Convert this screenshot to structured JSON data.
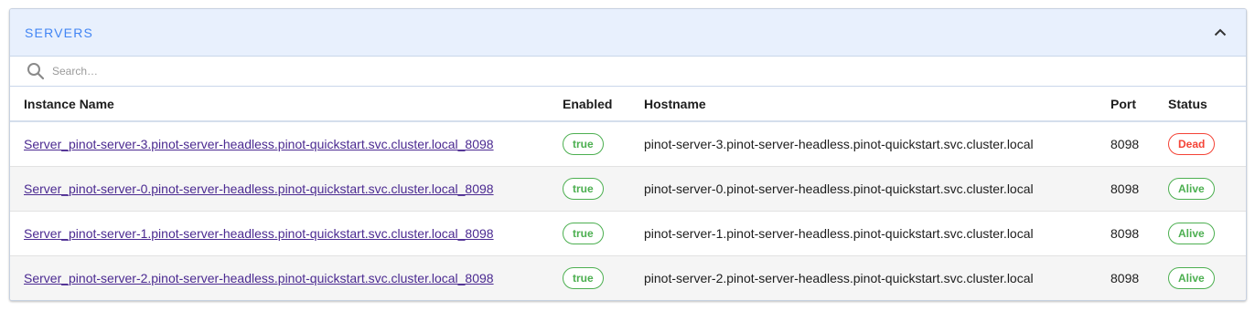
{
  "panel": {
    "title": "SERVERS",
    "collapse_icon": "chevron-up-icon"
  },
  "search": {
    "placeholder": "Search…",
    "value": "",
    "icon": "search-icon"
  },
  "table": {
    "columns": [
      "Instance Name",
      "Enabled",
      "Hostname",
      "Port",
      "Status"
    ],
    "rows": [
      {
        "instance_name": "Server_pinot-server-3.pinot-server-headless.pinot-quickstart.svc.cluster.local_8098",
        "enabled": "true",
        "hostname": "pinot-server-3.pinot-server-headless.pinot-quickstart.svc.cluster.local",
        "port": "8098",
        "status": "Dead"
      },
      {
        "instance_name": "Server_pinot-server-0.pinot-server-headless.pinot-quickstart.svc.cluster.local_8098",
        "enabled": "true",
        "hostname": "pinot-server-0.pinot-server-headless.pinot-quickstart.svc.cluster.local",
        "port": "8098",
        "status": "Alive"
      },
      {
        "instance_name": "Server_pinot-server-1.pinot-server-headless.pinot-quickstart.svc.cluster.local_8098",
        "enabled": "true",
        "hostname": "pinot-server-1.pinot-server-headless.pinot-quickstart.svc.cluster.local",
        "port": "8098",
        "status": "Alive"
      },
      {
        "instance_name": "Server_pinot-server-2.pinot-server-headless.pinot-quickstart.svc.cluster.local_8098",
        "enabled": "true",
        "hostname": "pinot-server-2.pinot-server-headless.pinot-quickstart.svc.cluster.local",
        "port": "8098",
        "status": "Alive"
      }
    ]
  },
  "colors": {
    "accent": "#4285f4",
    "header_bg": "#e8f0fd",
    "link": "#4b2a91",
    "status_ok": "#4caf50",
    "status_bad": "#f44336"
  }
}
